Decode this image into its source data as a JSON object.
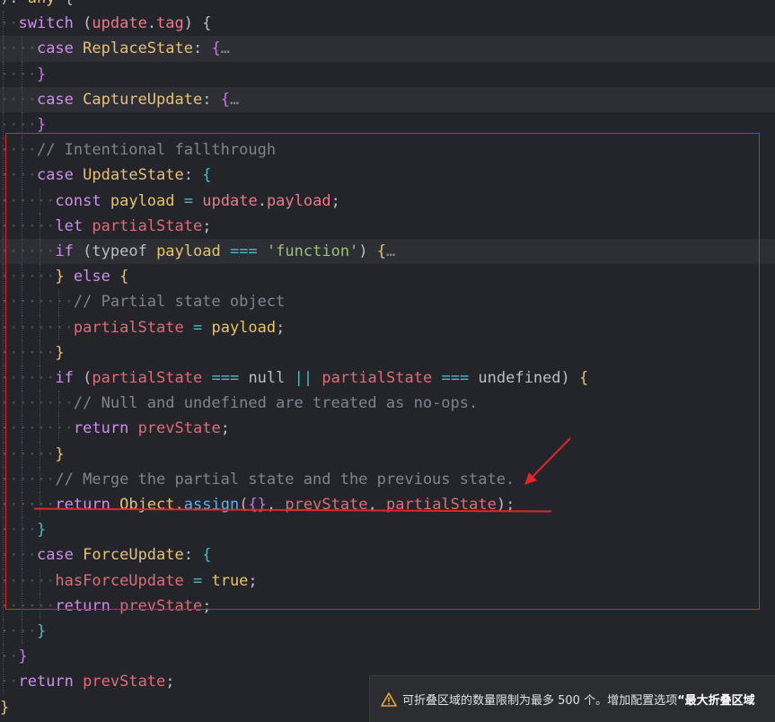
{
  "code_lines": [
    {
      "indent": 0,
      "hl": false,
      "tokens": [
        [
          "txt",
          "): "
        ],
        [
          "fn",
          "any"
        ],
        [
          "txt",
          " {"
        ]
      ]
    },
    {
      "indent": 1,
      "hl": false,
      "tokens": [
        [
          "kw",
          "switch"
        ],
        [
          "txt",
          " ("
        ],
        [
          "prop",
          "update"
        ],
        [
          "txt",
          "."
        ],
        [
          "prop",
          "tag"
        ],
        [
          "txt",
          ") {"
        ]
      ]
    },
    {
      "indent": 2,
      "hl": true,
      "tokens": [
        [
          "kw",
          "case"
        ],
        [
          "txt",
          " "
        ],
        [
          "ty",
          "ReplaceState"
        ],
        [
          "txt",
          ": "
        ],
        [
          "brace2",
          "{"
        ],
        [
          "fold",
          "…"
        ]
      ]
    },
    {
      "indent": 2,
      "hl": false,
      "tokens": [
        [
          "brace2",
          "}"
        ]
      ]
    },
    {
      "indent": 2,
      "hl": true,
      "tokens": [
        [
          "kw",
          "case"
        ],
        [
          "txt",
          " "
        ],
        [
          "ty",
          "CaptureUpdate"
        ],
        [
          "txt",
          ": "
        ],
        [
          "brace2",
          "{"
        ],
        [
          "fold",
          "…"
        ]
      ]
    },
    {
      "indent": 2,
      "hl": false,
      "tokens": [
        [
          "brace2",
          "}"
        ]
      ]
    },
    {
      "indent": 2,
      "hl": false,
      "tokens": [
        [
          "cm",
          "// Intentional fallthrough"
        ]
      ]
    },
    {
      "indent": 2,
      "hl": false,
      "tokens": [
        [
          "kw",
          "case"
        ],
        [
          "txt",
          " "
        ],
        [
          "ty",
          "UpdateState"
        ],
        [
          "txt",
          ": "
        ],
        [
          "op",
          "{"
        ]
      ]
    },
    {
      "indent": 3,
      "hl": false,
      "tokens": [
        [
          "kw",
          "const"
        ],
        [
          "txt",
          " "
        ],
        [
          "fn",
          "payload"
        ],
        [
          "txt",
          " "
        ],
        [
          "op",
          "="
        ],
        [
          "txt",
          " "
        ],
        [
          "prop",
          "update"
        ],
        [
          "txt",
          "."
        ],
        [
          "prop",
          "payload"
        ],
        [
          "txt",
          ";"
        ]
      ]
    },
    {
      "indent": 3,
      "hl": false,
      "tokens": [
        [
          "kw",
          "let"
        ],
        [
          "txt",
          " "
        ],
        [
          "var",
          "partialState"
        ],
        [
          "txt",
          ";"
        ]
      ]
    },
    {
      "indent": 3,
      "hl": true,
      "tokens": [
        [
          "kw",
          "if"
        ],
        [
          "txt",
          " ("
        ],
        [
          "txt",
          "typeof"
        ],
        [
          "txt",
          " "
        ],
        [
          "fn",
          "payload"
        ],
        [
          "txt",
          " "
        ],
        [
          "op",
          "==="
        ],
        [
          "txt",
          " "
        ],
        [
          "str",
          "'function'"
        ],
        [
          "txt",
          ") "
        ],
        [
          "brace",
          "{"
        ],
        [
          "fold",
          "…"
        ]
      ]
    },
    {
      "indent": 3,
      "hl": false,
      "tokens": [
        [
          "brace",
          "}"
        ],
        [
          "txt",
          " "
        ],
        [
          "kw",
          "else"
        ],
        [
          "txt",
          " "
        ],
        [
          "brace",
          "{"
        ]
      ]
    },
    {
      "indent": 4,
      "hl": false,
      "tokens": [
        [
          "cm",
          "// Partial state object"
        ]
      ]
    },
    {
      "indent": 4,
      "hl": false,
      "tokens": [
        [
          "var",
          "partialState"
        ],
        [
          "txt",
          " "
        ],
        [
          "op",
          "="
        ],
        [
          "txt",
          " "
        ],
        [
          "fn",
          "payload"
        ],
        [
          "txt",
          ";"
        ]
      ]
    },
    {
      "indent": 3,
      "hl": false,
      "tokens": [
        [
          "brace",
          "}"
        ]
      ]
    },
    {
      "indent": 3,
      "hl": false,
      "tokens": [
        [
          "kw",
          "if"
        ],
        [
          "txt",
          " ("
        ],
        [
          "var",
          "partialState"
        ],
        [
          "txt",
          " "
        ],
        [
          "op",
          "==="
        ],
        [
          "txt",
          " "
        ],
        [
          "txt",
          "null"
        ],
        [
          "txt",
          " "
        ],
        [
          "op",
          "||"
        ],
        [
          "txt",
          " "
        ],
        [
          "var",
          "partialState"
        ],
        [
          "txt",
          " "
        ],
        [
          "op",
          "==="
        ],
        [
          "txt",
          " "
        ],
        [
          "txt",
          "undefined"
        ],
        [
          "txt",
          ") "
        ],
        [
          "brace",
          "{"
        ]
      ]
    },
    {
      "indent": 4,
      "hl": false,
      "tokens": [
        [
          "cm",
          "// Null and undefined are treated as no-ops."
        ]
      ]
    },
    {
      "indent": 4,
      "hl": false,
      "tokens": [
        [
          "kw",
          "return"
        ],
        [
          "txt",
          " "
        ],
        [
          "var",
          "prevState"
        ],
        [
          "txt",
          ";"
        ]
      ]
    },
    {
      "indent": 3,
      "hl": false,
      "tokens": [
        [
          "brace",
          "}"
        ]
      ]
    },
    {
      "indent": 3,
      "hl": false,
      "tokens": [
        [
          "cm",
          "// Merge the partial state and the previous state."
        ]
      ]
    },
    {
      "indent": 3,
      "hl": false,
      "tokens": [
        [
          "kw",
          "return"
        ],
        [
          "txt",
          " "
        ],
        [
          "fn",
          "Object"
        ],
        [
          "txt",
          "."
        ],
        [
          "meth",
          "assign"
        ],
        [
          "txt",
          "("
        ],
        [
          "brace2",
          "{}"
        ],
        [
          "txt",
          ", "
        ],
        [
          "var",
          "prevState"
        ],
        [
          "txt",
          ", "
        ],
        [
          "var",
          "partialState"
        ],
        [
          "txt",
          ");"
        ]
      ]
    },
    {
      "indent": 2,
      "hl": false,
      "tokens": [
        [
          "op",
          "}"
        ]
      ]
    },
    {
      "indent": 2,
      "hl": false,
      "tokens": [
        [
          "kw",
          "case"
        ],
        [
          "txt",
          " "
        ],
        [
          "ty",
          "ForceUpdate"
        ],
        [
          "txt",
          ": "
        ],
        [
          "op",
          "{"
        ]
      ]
    },
    {
      "indent": 3,
      "hl": false,
      "tokens": [
        [
          "var",
          "hasForceUpdate"
        ],
        [
          "txt",
          " "
        ],
        [
          "op",
          "="
        ],
        [
          "txt",
          " "
        ],
        [
          "fn",
          "true"
        ],
        [
          "txt",
          ";"
        ]
      ]
    },
    {
      "indent": 3,
      "hl": false,
      "tokens": [
        [
          "kw",
          "return"
        ],
        [
          "txt",
          " "
        ],
        [
          "var",
          "prevState"
        ],
        [
          "txt",
          ";"
        ]
      ]
    },
    {
      "indent": 2,
      "hl": false,
      "tokens": [
        [
          "op",
          "}"
        ]
      ]
    },
    {
      "indent": 1,
      "hl": false,
      "tokens": [
        [
          "brace2",
          "}"
        ]
      ]
    },
    {
      "indent": 1,
      "hl": false,
      "tokens": [
        [
          "kw",
          "return"
        ],
        [
          "txt",
          " "
        ],
        [
          "var",
          "prevState"
        ],
        [
          "txt",
          ";"
        ]
      ]
    },
    {
      "indent": 0,
      "hl": false,
      "tokens": [
        [
          "brace",
          "}"
        ]
      ]
    }
  ],
  "toast": {
    "icon": "warning-icon",
    "message": "可折叠区域的数量限制为最多 500 个。增加配置选项",
    "option": "“最大折叠区域"
  },
  "annotation_color": "#e0262c"
}
